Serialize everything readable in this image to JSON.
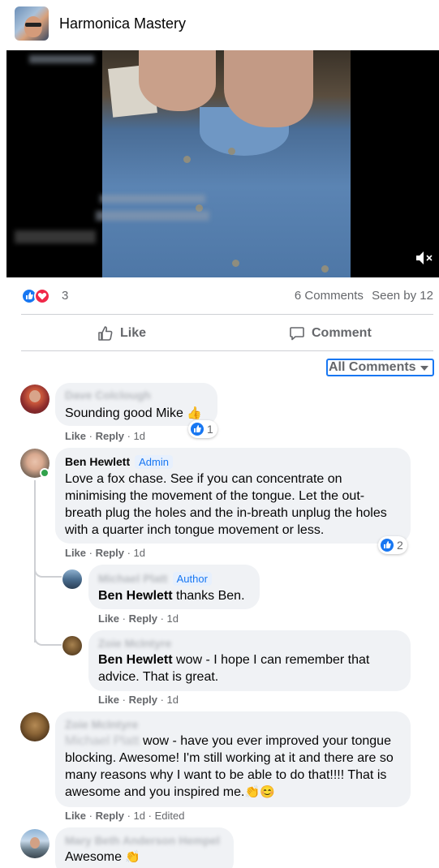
{
  "header": {
    "title": "Harmonica Mastery"
  },
  "reactions": {
    "count": "3",
    "comments": "6 Comments",
    "seen": "Seen by 12"
  },
  "actions": {
    "like": "Like",
    "comment": "Comment"
  },
  "filter": {
    "label": "All Comments"
  },
  "comments": [
    {
      "name": "Dave Colclough",
      "text": "Sounding good Mike",
      "emoji": "👍",
      "like": "Like",
      "reply": "Reply",
      "time": "1d",
      "reaction_count": "1"
    },
    {
      "name": "Ben Hewlett",
      "tag": "Admin",
      "text": "Love a fox chase. See if you can concentrate on minimising the movement of the tongue. Let the out-breath plug the holes and the in-breath unplug the holes with a quarter inch tongue movement or less.",
      "like": "Like",
      "reply": "Reply",
      "time": "1d",
      "reaction_count": "2",
      "replies": [
        {
          "name": "Michael Platt",
          "tag": "Author",
          "mention": "Ben Hewlett",
          "text": " thanks Ben.",
          "like": "Like",
          "reply": "Reply",
          "time": "1d"
        },
        {
          "name": "Zoie McIntyre",
          "mention": "Ben Hewlett",
          "text": " wow - I hope I can remember that advice. That is great.",
          "like": "Like",
          "reply": "Reply",
          "time": "1d"
        }
      ]
    },
    {
      "name": "Zoie McIntyre",
      "mention": "Michael Platt",
      "text": " wow - have you ever improved your tongue blocking. Awesome! I'm still working at it and there are so many reasons why I want to be able to do that!!!! That is awesome and you inspired me.",
      "emoji": "👏😊",
      "like": "Like",
      "reply": "Reply",
      "time": "1d",
      "edited": "Edited"
    },
    {
      "name": "Mary Beth Anderson Hempel",
      "text": "Awesome",
      "emoji": "👏"
    }
  ],
  "colors": {
    "accent": "#1877f2",
    "love": "#f02849",
    "bubble": "#f0f2f5",
    "meta": "#65676b"
  },
  "icons": [
    "mute-icon",
    "like-thumb-icon",
    "comment-icon",
    "caret-down-icon"
  ]
}
